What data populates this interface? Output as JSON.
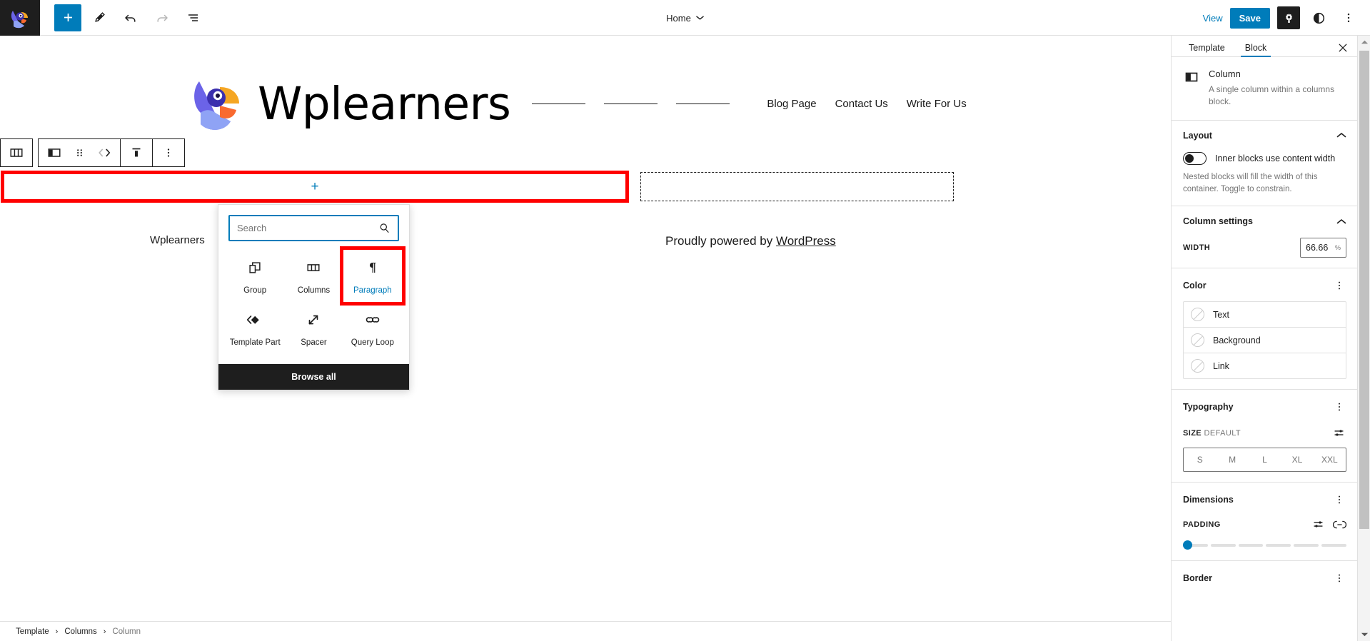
{
  "topbar": {
    "logo_icon": "wordpress-bird-logo-icon",
    "add_block_label": "+",
    "tools": [
      {
        "name": "add-block-button",
        "icon": "plus-icon"
      },
      {
        "name": "edit-tool-button",
        "icon": "pencil-icon"
      },
      {
        "name": "undo-button",
        "icon": "undo-arrow-icon"
      },
      {
        "name": "redo-button",
        "icon": "redo-arrow-icon"
      },
      {
        "name": "list-view-button",
        "icon": "list-view-icon"
      }
    ],
    "document_title": "Home",
    "view_label": "View",
    "save_label": "Save",
    "settings_icon": "gear-icon",
    "styles_icon": "contrast-half-circle-icon",
    "options_icon": "vertical-ellipsis-icon"
  },
  "site": {
    "logo_icon": "wplearners-parrot-logo-icon",
    "title": "Wplearners",
    "nav_dashes": 3,
    "nav_links": [
      "Blog Page",
      "Contact Us",
      "Write For Us"
    ]
  },
  "block_toolbar": {
    "items": [
      {
        "name": "block-type-columns-icon",
        "icon": "columns-icon"
      },
      {
        "name": "change-alignment-icon",
        "icon": "column-align-icon"
      },
      {
        "name": "drag-handle-icon",
        "icon": "six-dots-drag-icon"
      },
      {
        "name": "move-left-right-icon",
        "icon": "chevron-left-right-icon"
      },
      {
        "name": "align-top-icon",
        "icon": "vertical-align-top-icon"
      },
      {
        "name": "more-options-icon",
        "icon": "vertical-ellipsis-icon"
      }
    ]
  },
  "canvas": {
    "left_column_appender": "+",
    "footer_left_text": "Wplearners",
    "footer_right_prefix": "Proudly powered by ",
    "footer_right_link": "WordPress"
  },
  "inserter": {
    "search_placeholder": "Search",
    "search_value": "",
    "search_icon": "magnifier-icon",
    "blocks": [
      {
        "label": "Group",
        "icon": "group-blocks-icon",
        "selected": false
      },
      {
        "label": "Columns",
        "icon": "columns-icon",
        "selected": false
      },
      {
        "label": "Paragraph",
        "icon": "pilcrow-paragraph-icon",
        "selected": true
      },
      {
        "label": "Template Part",
        "icon": "template-part-diamond-icon",
        "selected": false
      },
      {
        "label": "Spacer",
        "icon": "diagonal-resize-arrow-icon",
        "selected": false
      },
      {
        "label": "Query Loop",
        "icon": "infinity-loop-icon",
        "selected": false
      }
    ],
    "browse_all_label": "Browse all"
  },
  "sidebar": {
    "tabs": [
      {
        "label": "Template",
        "active": false
      },
      {
        "label": "Block",
        "active": true
      }
    ],
    "close_icon": "close-x-icon",
    "block_info": {
      "icon": "column-block-icon",
      "title": "Column",
      "description": "A single column within a columns block."
    },
    "layout": {
      "title": "Layout",
      "chevron": "chevron-up-icon",
      "toggle_label": "Inner blocks use content width",
      "toggle_on": false,
      "help": "Nested blocks will fill the width of this container. Toggle to constrain."
    },
    "column_settings": {
      "title": "Column settings",
      "chevron": "chevron-up-icon",
      "width_label": "WIDTH",
      "width_value": "66.66",
      "width_unit": "%"
    },
    "color": {
      "title": "Color",
      "kebab": "vertical-ellipsis-icon",
      "rows": [
        {
          "label": "Text",
          "swatch": "empty-color-swatch-icon"
        },
        {
          "label": "Background",
          "swatch": "empty-color-swatch-icon"
        },
        {
          "label": "Link",
          "swatch": "empty-color-swatch-icon"
        }
      ]
    },
    "typography": {
      "title": "Typography",
      "kebab": "vertical-ellipsis-icon",
      "size_label": "SIZE",
      "size_value": "DEFAULT",
      "settings_icon": "sliders-icon",
      "sizes": [
        "S",
        "M",
        "L",
        "XL",
        "XXL"
      ]
    },
    "dimensions": {
      "title": "Dimensions",
      "kebab": "vertical-ellipsis-icon",
      "padding_label": "PADDING",
      "padding_settings_icon": "sliders-icon",
      "padding_link_icon": "link-sides-icon",
      "padding_steps": 6,
      "padding_active_step": 0
    },
    "border": {
      "title": "Border",
      "kebab": "vertical-ellipsis-icon"
    },
    "scrollbar": {
      "up_icon": "triangle-up-icon",
      "down_icon": "triangle-down-icon"
    }
  },
  "breadcrumb": {
    "items": [
      "Template",
      "Columns",
      "Column"
    ],
    "separator": "›"
  },
  "colors": {
    "accent": "#007cba",
    "highlight_red": "#ff0000",
    "dark": "#1e1e1e",
    "muted": "#757575"
  }
}
